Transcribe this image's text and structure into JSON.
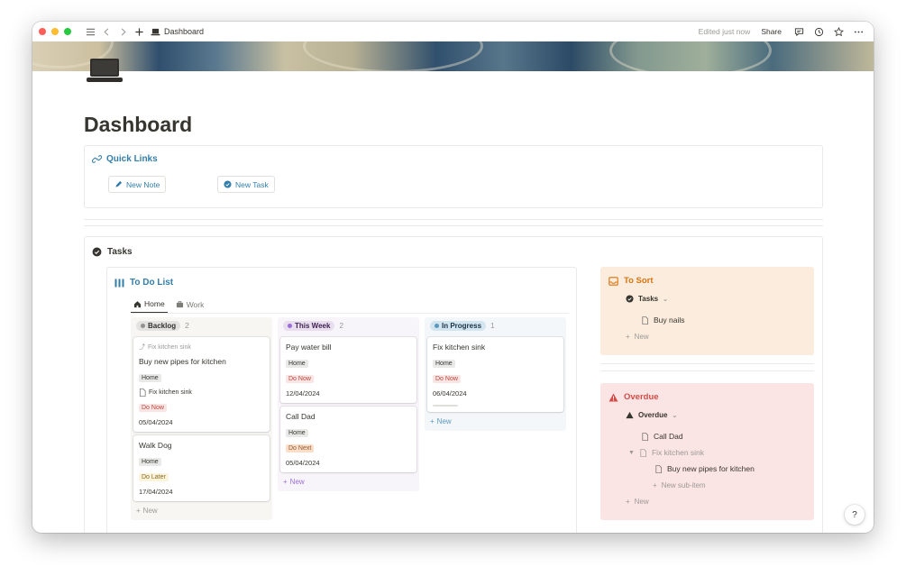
{
  "titlebar": {
    "page_name": "Dashboard",
    "edited": "Edited just now",
    "share": "Share"
  },
  "page": {
    "title": "Dashboard"
  },
  "quick_links": {
    "title": "Quick Links",
    "buttons": [
      {
        "label": "New Note"
      },
      {
        "label": "New Task"
      }
    ]
  },
  "tasks": {
    "title": "Tasks",
    "todo": {
      "title": "To Do List",
      "tabs": [
        {
          "label": "Home"
        },
        {
          "label": "Work"
        }
      ],
      "columns": [
        {
          "name": "Backlog",
          "count": "2",
          "cards": [
            {
              "parent": "Fix kitchen sink",
              "title": "Buy new pipes for kitchen",
              "tag": "Home",
              "sub": "Fix kitchen sink",
              "status": "Do Now",
              "date": "05/04/2024"
            },
            {
              "title": "Walk Dog",
              "tag": "Home",
              "status": "Do Later",
              "date": "17/04/2024"
            }
          ],
          "new": "New"
        },
        {
          "name": "This Week",
          "count": "2",
          "cards": [
            {
              "title": "Pay water bill",
              "tag": "Home",
              "status": "Do Now",
              "date": "12/04/2024"
            },
            {
              "title": "Call Dad",
              "tag": "Home",
              "status": "Do Next",
              "date": "05/04/2024"
            }
          ],
          "new": "New"
        },
        {
          "name": "In Progress",
          "count": "1",
          "cards": [
            {
              "title": "Fix kitchen sink",
              "tag": "Home",
              "status": "Do Now",
              "date": "06/04/2024"
            }
          ],
          "new": "New"
        }
      ]
    }
  },
  "to_sort": {
    "title": "To Sort",
    "group": "Tasks",
    "items": [
      "Buy nails"
    ],
    "new": "New"
  },
  "overdue": {
    "title": "Overdue",
    "group": "Overdue",
    "items": [
      "Call Dad",
      "Fix kitchen sink",
      "Buy new pipes for kitchen"
    ],
    "new_sub": "New sub-item",
    "new": "New"
  },
  "help": "?"
}
